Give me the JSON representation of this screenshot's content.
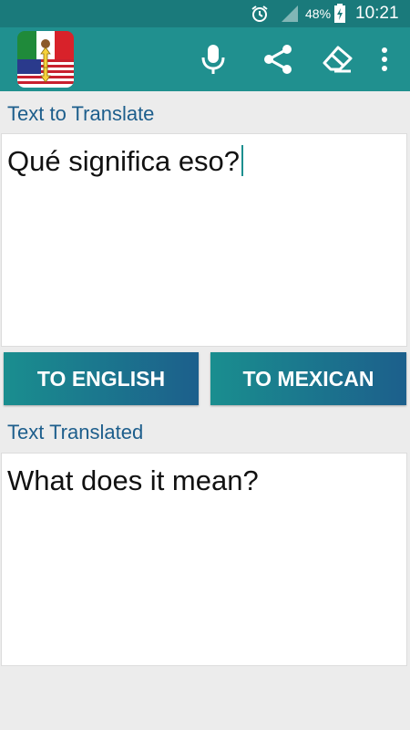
{
  "status_bar": {
    "icons": [
      "alarm-icon",
      "signal-icon",
      "battery-charging-icon"
    ],
    "battery_percent": "48%",
    "time": "10:21"
  },
  "toolbar": {
    "logo": "mexico-usa-flags-logo",
    "actions": [
      "microphone-icon",
      "share-icon",
      "eraser-icon",
      "more-vert-icon"
    ]
  },
  "input": {
    "label": "Text to Translate",
    "value": "Qué significa eso?"
  },
  "buttons": {
    "to_english": "TO ENGLISH",
    "to_mexican": "TO MEXICAN"
  },
  "output": {
    "label": "Text Translated",
    "value": "What does it mean?"
  },
  "colors": {
    "toolbar": "#20908f",
    "status_bar": "#1a7a7b",
    "label": "#1d5e8c",
    "button_gradient_start": "#1a8e8f",
    "button_gradient_end": "#1c5f8c"
  }
}
